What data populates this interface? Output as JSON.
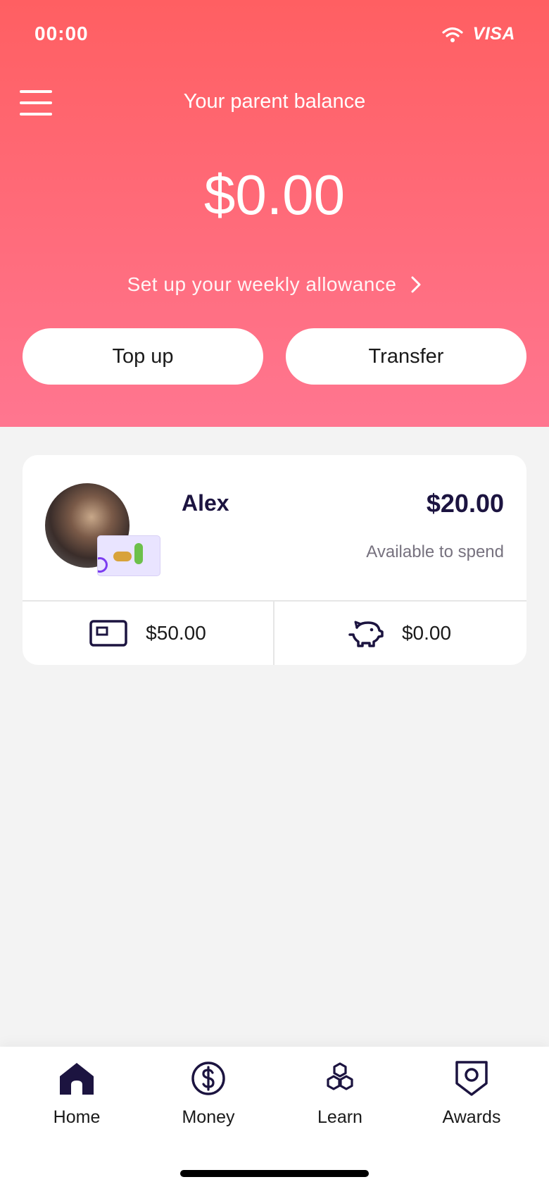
{
  "status_bar": {
    "time": "00:00",
    "brand": "VISA"
  },
  "header": {
    "title": "Your parent balance",
    "balance": "$0.00",
    "allowance_link": "Set up your weekly allowance",
    "topup_label": "Top up",
    "transfer_label": "Transfer"
  },
  "child": {
    "name": "Alex",
    "amount": "$20.00",
    "available_label": "Available to spend",
    "card_balance": "$50.00",
    "savings_balance": "$0.00"
  },
  "tabs": [
    {
      "label": "Home",
      "icon": "home-icon"
    },
    {
      "label": "Money",
      "icon": "dollar-circle-icon"
    },
    {
      "label": "Learn",
      "icon": "hexagons-icon"
    },
    {
      "label": "Awards",
      "icon": "shield-badge-icon"
    }
  ],
  "colors": {
    "header_top": "#ff5f62",
    "header_bottom": "#ff7690",
    "navy": "#1c1440",
    "background": "#f3f3f3"
  }
}
